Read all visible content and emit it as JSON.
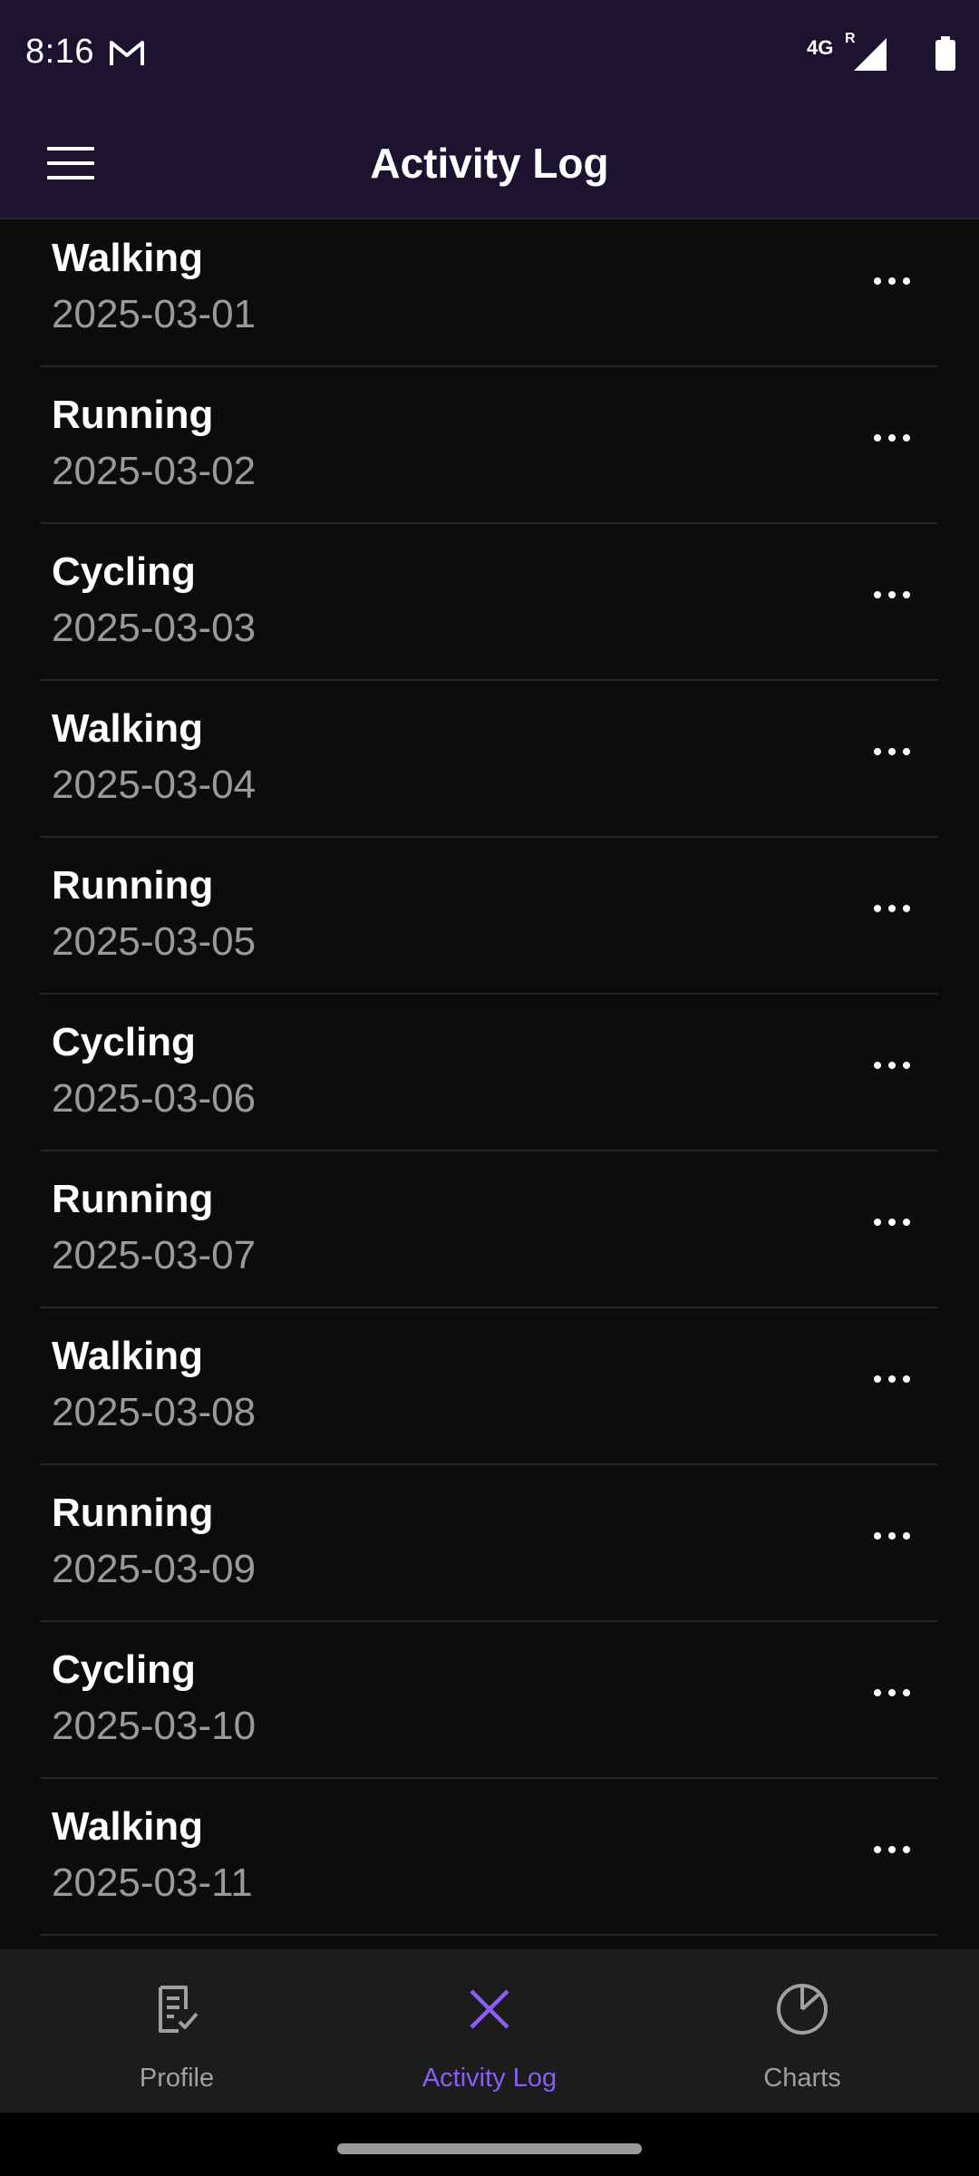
{
  "status_bar": {
    "time": "8:16",
    "network": "4G",
    "roaming": "R",
    "icons": [
      "gmail-icon",
      "signal-icon",
      "battery-icon"
    ]
  },
  "app_bar": {
    "title": "Activity Log",
    "menu_icon": "hamburger-menu-icon"
  },
  "activities": [
    {
      "title": "Walking",
      "date": "2025-03-01"
    },
    {
      "title": "Running",
      "date": "2025-03-02"
    },
    {
      "title": "Cycling",
      "date": "2025-03-03"
    },
    {
      "title": "Walking",
      "date": "2025-03-04"
    },
    {
      "title": "Running",
      "date": "2025-03-05"
    },
    {
      "title": "Cycling",
      "date": "2025-03-06"
    },
    {
      "title": "Running",
      "date": "2025-03-07"
    },
    {
      "title": "Walking",
      "date": "2025-03-08"
    },
    {
      "title": "Running",
      "date": "2025-03-09"
    },
    {
      "title": "Cycling",
      "date": "2025-03-10"
    },
    {
      "title": "Walking",
      "date": "2025-03-11"
    }
  ],
  "bottom_nav": {
    "items": [
      {
        "label": "Profile",
        "icon": "checklist-document-icon",
        "active": false
      },
      {
        "label": "Activity Log",
        "icon": "close-x-icon",
        "active": true
      },
      {
        "label": "Charts",
        "icon": "pie-chart-icon",
        "active": false
      }
    ]
  },
  "colors": {
    "header_bg": "#1c1330",
    "list_bg": "#0c0c0c",
    "accent": "#8b5cf6",
    "inactive_nav": "#a0a0a0",
    "date_text": "#9a9a9a"
  }
}
